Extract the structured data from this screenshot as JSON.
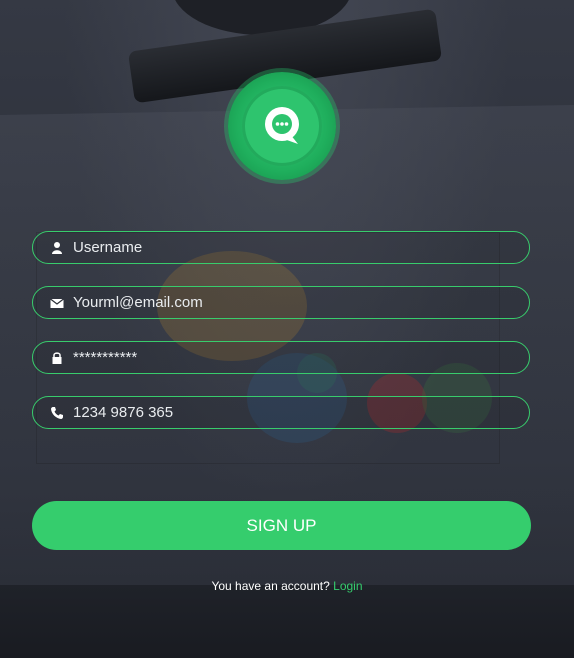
{
  "form": {
    "username": {
      "value": "Username",
      "icon": "user-icon"
    },
    "email": {
      "value": "Yourml@email.com",
      "icon": "envelope-icon"
    },
    "password": {
      "value": "***********",
      "icon": "lock-icon"
    },
    "phone": {
      "value": "1234 9876 365",
      "icon": "phone-icon"
    }
  },
  "signup_button": {
    "label": "SIGN UP"
  },
  "footer": {
    "prompt": "You have an account?",
    "link": "Login"
  },
  "logo": {
    "icon": "chat-bubble-icon"
  },
  "colors": {
    "accent": "#35cd6d",
    "background": "#2b2f38"
  }
}
